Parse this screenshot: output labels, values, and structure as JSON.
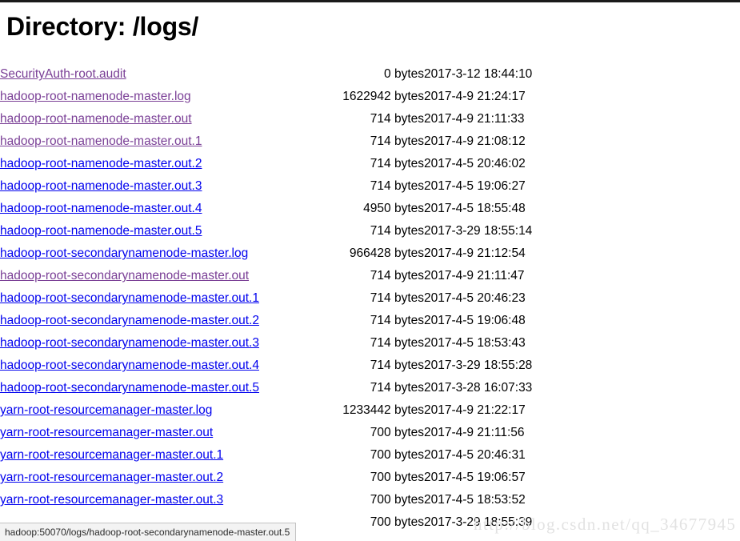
{
  "page": {
    "title": "Directory: /logs/",
    "watermark": "http://blog.csdn.net/qq_34677945"
  },
  "status_bar": {
    "url": "hadoop:50070/logs/hadoop-root-secondarynamenode-master.out.5"
  },
  "colors": {
    "link": "#0000ee",
    "visited_link": "#7a3f96",
    "text": "#000000",
    "status_bar_background": "#f3f3f3",
    "status_bar_border": "#c2c2c2",
    "watermark": "#e2e2e2",
    "top_border": "#1a1a1a"
  },
  "listing": {
    "size_unit": "bytes",
    "rows": [
      {
        "name": "SecurityAuth-root.audit",
        "size": "0 bytes",
        "date": "2017-3-12 18:44:10",
        "visited": true
      },
      {
        "name": "hadoop-root-namenode-master.log",
        "size": "1622942 bytes",
        "date": "2017-4-9 21:24:17",
        "visited": true
      },
      {
        "name": "hadoop-root-namenode-master.out",
        "size": "714 bytes",
        "date": "2017-4-9 21:11:33",
        "visited": true
      },
      {
        "name": "hadoop-root-namenode-master.out.1",
        "size": "714 bytes",
        "date": "2017-4-9 21:08:12",
        "visited": true
      },
      {
        "name": "hadoop-root-namenode-master.out.2",
        "size": "714 bytes",
        "date": "2017-4-5 20:46:02",
        "visited": false
      },
      {
        "name": "hadoop-root-namenode-master.out.3",
        "size": "714 bytes",
        "date": "2017-4-5 19:06:27",
        "visited": false
      },
      {
        "name": "hadoop-root-namenode-master.out.4",
        "size": "4950 bytes",
        "date": "2017-4-5 18:55:48",
        "visited": false
      },
      {
        "name": "hadoop-root-namenode-master.out.5",
        "size": "714 bytes",
        "date": "2017-3-29 18:55:14",
        "visited": false
      },
      {
        "name": "hadoop-root-secondarynamenode-master.log",
        "size": "966428 bytes",
        "date": "2017-4-9 21:12:54",
        "visited": false
      },
      {
        "name": "hadoop-root-secondarynamenode-master.out",
        "size": "714 bytes",
        "date": "2017-4-9 21:11:47",
        "visited": true
      },
      {
        "name": "hadoop-root-secondarynamenode-master.out.1",
        "size": "714 bytes",
        "date": "2017-4-5 20:46:23",
        "visited": false
      },
      {
        "name": "hadoop-root-secondarynamenode-master.out.2",
        "size": "714 bytes",
        "date": "2017-4-5 19:06:48",
        "visited": false
      },
      {
        "name": "hadoop-root-secondarynamenode-master.out.3",
        "size": "714 bytes",
        "date": "2017-4-5 18:53:43",
        "visited": false
      },
      {
        "name": "hadoop-root-secondarynamenode-master.out.4",
        "size": "714 bytes",
        "date": "2017-3-29 18:55:28",
        "visited": false
      },
      {
        "name": "hadoop-root-secondarynamenode-master.out.5",
        "size": "714 bytes",
        "date": "2017-3-28 16:07:33",
        "visited": false
      },
      {
        "name": "yarn-root-resourcemanager-master.log",
        "size": "1233442 bytes",
        "date": "2017-4-9 21:22:17",
        "visited": false
      },
      {
        "name": "yarn-root-resourcemanager-master.out",
        "size": "700 bytes",
        "date": "2017-4-9 21:11:56",
        "visited": false
      },
      {
        "name": "yarn-root-resourcemanager-master.out.1",
        "size": "700 bytes",
        "date": "2017-4-5 20:46:31",
        "visited": false
      },
      {
        "name": "yarn-root-resourcemanager-master.out.2",
        "size": "700 bytes",
        "date": "2017-4-5 19:06:57",
        "visited": false
      },
      {
        "name": "yarn-root-resourcemanager-master.out.3",
        "size": "700 bytes",
        "date": "2017-4-5 18:53:52",
        "visited": false
      },
      {
        "name": "",
        "size": "700 bytes",
        "date": "2017-3-29 18:55:39",
        "visited": false
      }
    ]
  }
}
